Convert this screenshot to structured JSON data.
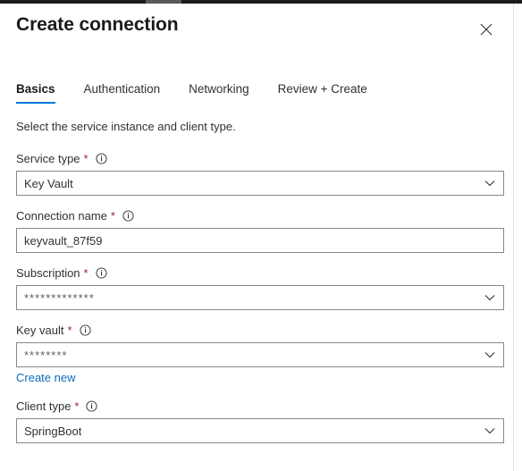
{
  "window": {
    "title": "Create connection",
    "close_label": "Close"
  },
  "tabs": [
    {
      "label": "Basics",
      "active": true
    },
    {
      "label": "Authentication",
      "active": false
    },
    {
      "label": "Networking",
      "active": false
    },
    {
      "label": "Review + Create",
      "active": false
    }
  ],
  "form": {
    "intro": "Select the service instance and client type.",
    "fields": [
      {
        "label": "Service type",
        "required": "*",
        "value": "Key Vault",
        "type": "dropdown"
      },
      {
        "label": "Connection name",
        "required": "*",
        "value": "keyvault_87f59",
        "type": "text"
      },
      {
        "label": "Subscription",
        "required": "*",
        "value": "*************",
        "type": "dropdown"
      },
      {
        "label": "Key vault",
        "required": "*",
        "value": "********",
        "type": "dropdown"
      },
      {
        "label": "Client type",
        "required": "*",
        "value": "SpringBoot",
        "type": "dropdown"
      }
    ],
    "create_new_link": "Create new"
  },
  "colors": {
    "accent": "#0078d4",
    "link": "#0f6cbd",
    "required": "#a4262c",
    "border": "#8a8886",
    "text": "#323130"
  }
}
